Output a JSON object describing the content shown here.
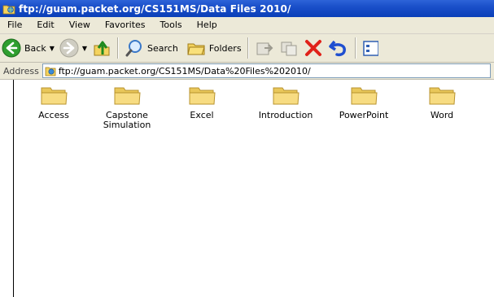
{
  "window": {
    "title": "ftp://guam.packet.org/CS151MS/Data Files 2010/"
  },
  "menu": [
    "File",
    "Edit",
    "View",
    "Favorites",
    "Tools",
    "Help"
  ],
  "toolbar": {
    "back_label": "Back",
    "search_label": "Search",
    "folders_label": "Folders"
  },
  "address": {
    "label": "Address",
    "value": "ftp://guam.packet.org/CS151MS/Data%20Files%202010/"
  },
  "folders": [
    {
      "name": "Access"
    },
    {
      "name": "Capstone Simulation"
    },
    {
      "name": "Excel"
    },
    {
      "name": "Introduction"
    },
    {
      "name": "PowerPoint"
    },
    {
      "name": "Word"
    }
  ],
  "icons": {
    "back": "back-arrow-icon",
    "forward": "forward-arrow-icon",
    "up": "up-folder-icon",
    "search": "search-icon",
    "folders": "folders-icon",
    "move_to": "move-to-icon",
    "copy_to": "copy-to-icon",
    "delete": "delete-icon",
    "undo": "undo-icon",
    "views": "views-icon",
    "folder": "folder-icon"
  },
  "colors": {
    "titlebar": "#0a3fb8",
    "chrome": "#ece9d8",
    "back_green": "#2f9e2f",
    "delete_red": "#e0221a",
    "undo_blue": "#1f4fd0"
  }
}
